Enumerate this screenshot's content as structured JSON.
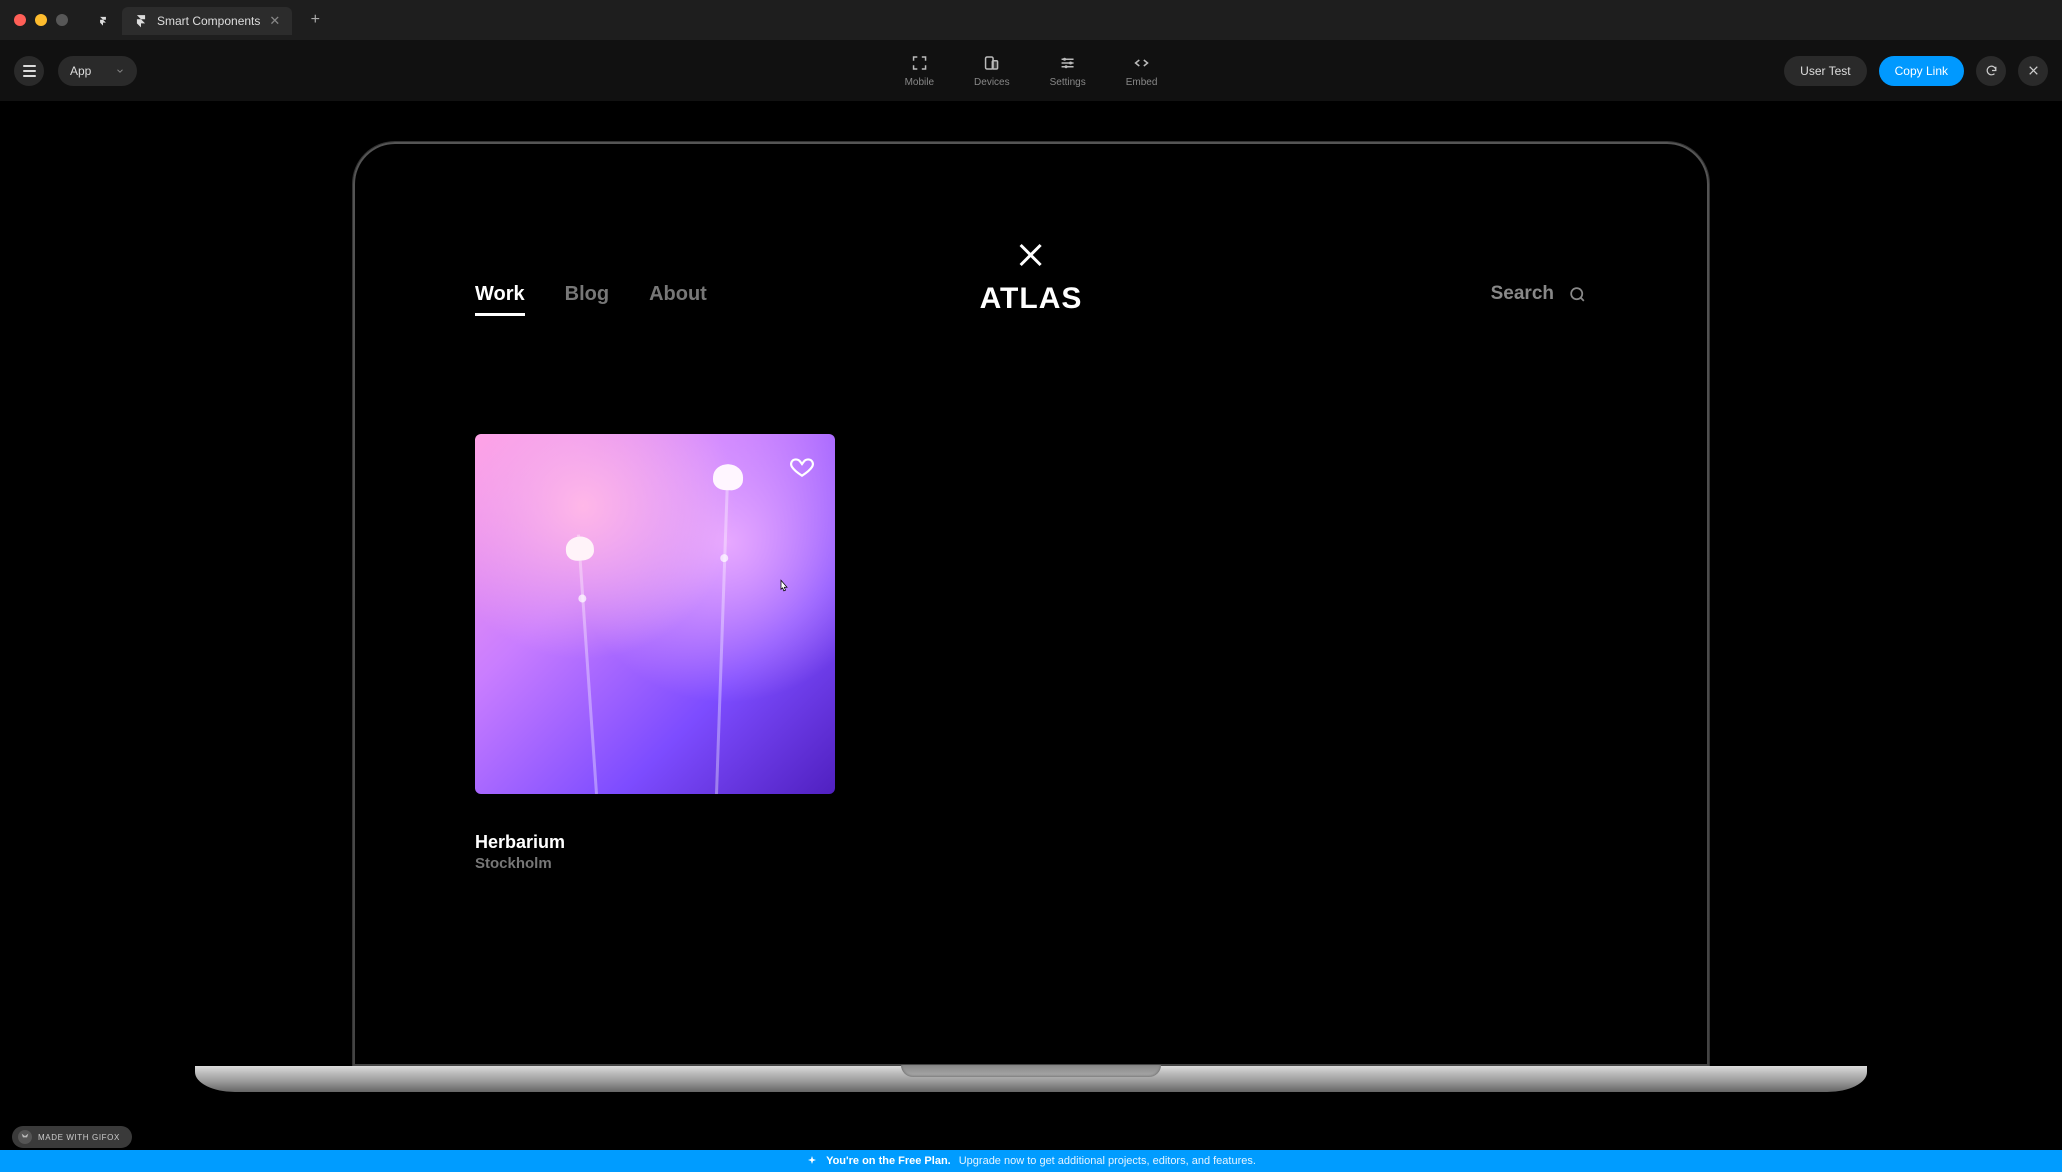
{
  "os": {
    "tab_title": "Smart Components"
  },
  "toolbar": {
    "page_select": "App",
    "center": {
      "mobile": "Mobile",
      "devices": "Devices",
      "settings": "Settings",
      "embed": "Embed"
    },
    "user_test": "User Test",
    "copy_link": "Copy Link"
  },
  "site": {
    "nav": {
      "work": "Work",
      "blog": "Blog",
      "about": "About"
    },
    "logo": "ATLAS",
    "search": "Search",
    "card": {
      "title": "Herbarium",
      "subtitle": "Stockholm"
    }
  },
  "watermark": "MADE WITH GIFOX",
  "banner": {
    "strong": "You're on the Free Plan.",
    "rest": "Upgrade now to get additional projects, editors, and features."
  }
}
